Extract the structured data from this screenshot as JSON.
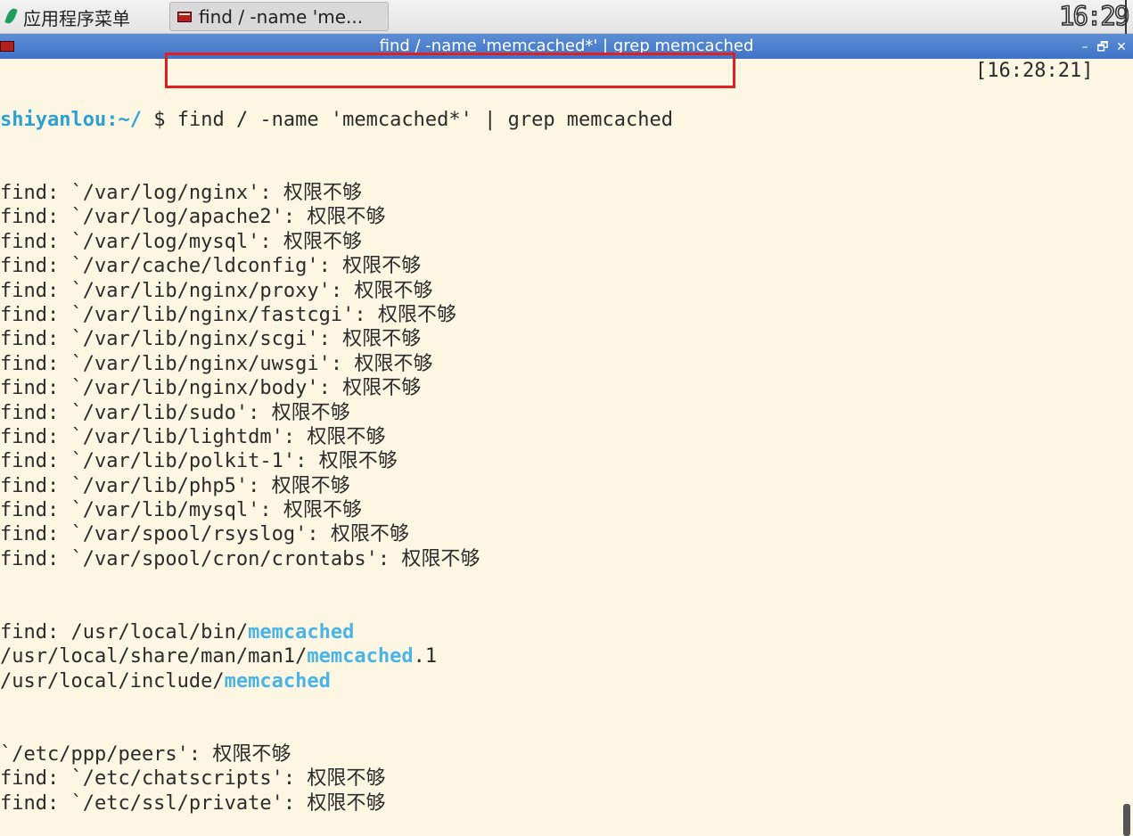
{
  "panel": {
    "app_menu_label": "应用程序菜单",
    "task_label": "find / -name 'me...",
    "clock": "16:29"
  },
  "window": {
    "title": "find / -name 'memcached*' | grep memcached",
    "minimize_glyph": "–",
    "maximize_glyph": "🗗",
    "close_glyph": "✕"
  },
  "terminal": {
    "prompt_user": "shiyanlou",
    "prompt_path": ":~/",
    "prompt_symbol": " $ ",
    "command": "find / -name 'memcached*' | grep memcached",
    "timestamp": "[16:28:21]",
    "lines": [
      "find: `/var/log/nginx': 权限不够",
      "find: `/var/log/apache2': 权限不够",
      "find: `/var/log/mysql': 权限不够",
      "find: `/var/cache/ldconfig': 权限不够",
      "find: `/var/lib/nginx/proxy': 权限不够",
      "find: `/var/lib/nginx/fastcgi': 权限不够",
      "find: `/var/lib/nginx/scgi': 权限不够",
      "find: `/var/lib/nginx/uwsgi': 权限不够",
      "find: `/var/lib/nginx/body': 权限不够",
      "find: `/var/lib/sudo': 权限不够",
      "find: `/var/lib/lightdm': 权限不够",
      "find: `/var/lib/polkit-1': 权限不够",
      "find: `/var/lib/php5': 权限不够",
      "find: `/var/lib/mysql': 权限不够",
      "find: `/var/spool/rsyslog': 权限不够",
      "find: `/var/spool/cron/crontabs': 权限不够"
    ],
    "match_lines": [
      {
        "before": "find: /usr/local/bin/",
        "match": "memcached",
        "after": ""
      },
      {
        "before": "/usr/local/share/man/man1/",
        "match": "memcached",
        "after": ".1"
      },
      {
        "before": "/usr/local/include/",
        "match": "memcached",
        "after": ""
      }
    ],
    "tail_lines": [
      "`/etc/ppp/peers': 权限不够",
      "find: `/etc/chatscripts': 权限不够",
      "find: `/etc/ssl/private': 权限不够"
    ],
    "highlight_color": "#e02020",
    "match_color": "#49b4e6",
    "background": "#fdf6e3"
  }
}
